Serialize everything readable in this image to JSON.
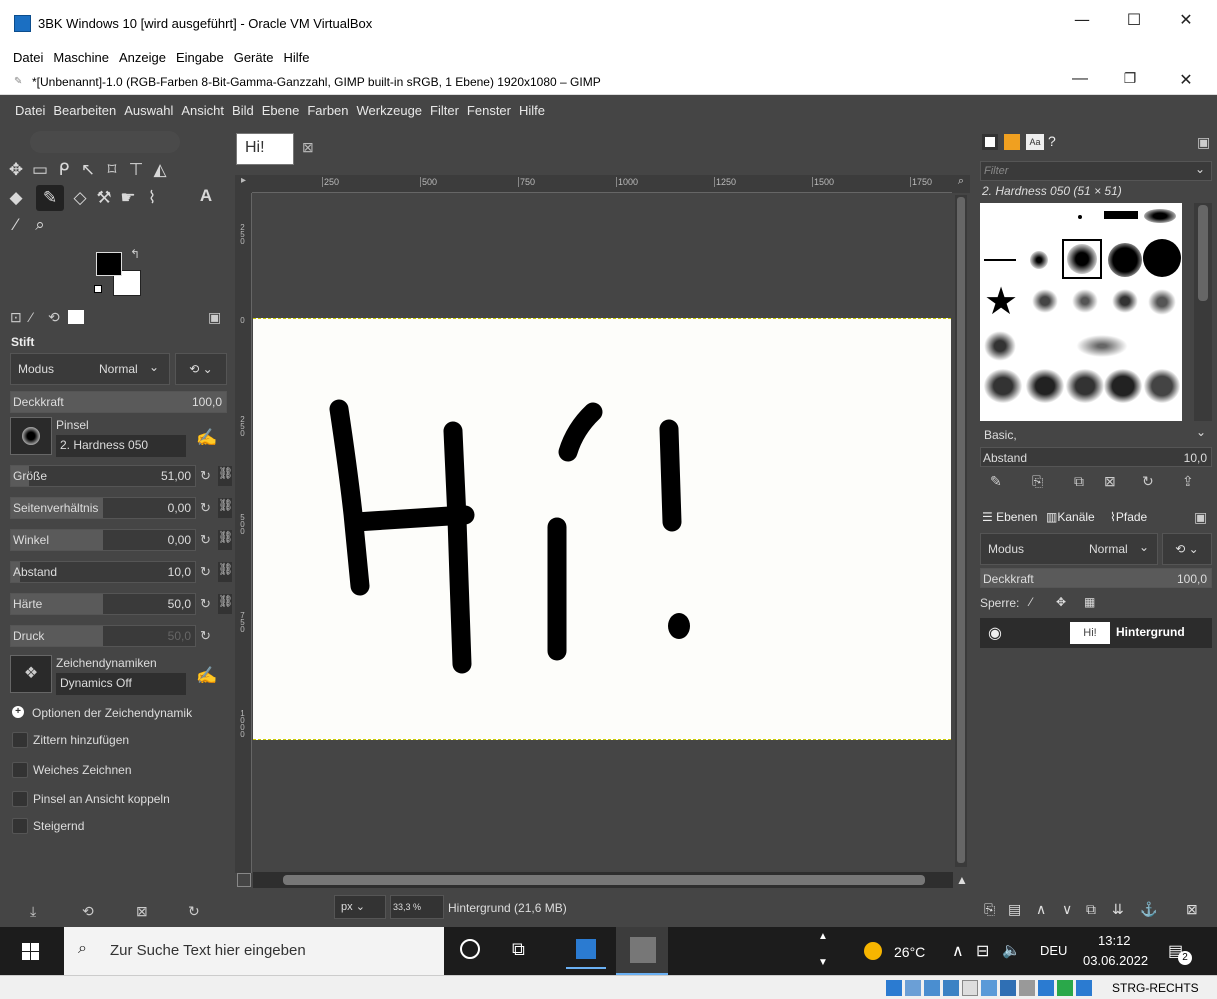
{
  "vbox": {
    "title": "3BK Windows 10 [wird ausgeführt] - Oracle VM VirtualBox",
    "menu": [
      "Datei",
      "Maschine",
      "Anzeige",
      "Eingabe",
      "Geräte",
      "Hilfe"
    ]
  },
  "gimp": {
    "title": "*[Unbenannt]-1.0 (RGB-Farben 8-Bit-Gamma-Ganzzahl, GIMP built-in sRGB, 1 Ebene) 1920x1080 – GIMP",
    "menu": [
      "Datei",
      "Bearbeiten",
      "Auswahl",
      "Ansicht",
      "Bild",
      "Ebene",
      "Farben",
      "Werkzeuge",
      "Filter",
      "Fenster",
      "Hilfe"
    ],
    "tab_thumb": "Hi!",
    "ruler": [
      "250",
      "500",
      "750",
      "1000",
      "1250",
      "1500",
      "1750"
    ],
    "vruler": [
      "250",
      "0",
      "250",
      "500",
      "750",
      "1000"
    ],
    "tool_options": {
      "heading": "Stift",
      "mode_label": "Modus",
      "mode_value": "Normal",
      "opacity_label": "Deckkraft",
      "opacity_value": "100,0",
      "brush_label": "Pinsel",
      "brush_name": "2. Hardness 050",
      "sliders": [
        {
          "label": "Größe",
          "value": "51,00",
          "fill": 0.1
        },
        {
          "label": "Seitenverhältnis",
          "value": "0,00",
          "fill": 0.5
        },
        {
          "label": "Winkel",
          "value": "0,00",
          "fill": 0.5
        },
        {
          "label": "Abstand",
          "value": "10,0",
          "fill": 0.05
        },
        {
          "label": "Härte",
          "value": "50,0",
          "fill": 0.5
        },
        {
          "label": "Druck",
          "value": "50,0",
          "fill": 0.5
        }
      ],
      "dynamics_label": "Zeichendynamiken",
      "dynamics_value": "Dynamics Off",
      "dynamics_options": "Optionen der Zeichendynamik",
      "checks": [
        "Zittern hinzufügen",
        "Weiches Zeichnen",
        "Pinsel an Ansicht koppeln",
        "Steigernd"
      ]
    },
    "statusbar": {
      "unit": "px",
      "zoom": "33,3 %",
      "layer_info": "Hintergrund (21,6 MB)"
    },
    "brushes": {
      "filter_placeholder": "Filter",
      "selected": "2. Hardness 050 (51 × 51)",
      "tag": "Basic,",
      "spacing_label": "Abstand",
      "spacing_value": "10,0"
    },
    "layers": {
      "tabs": [
        "Ebenen",
        "Kanäle",
        "Pfade"
      ],
      "mode_label": "Modus",
      "mode_value": "Normal",
      "opacity_label": "Deckkraft",
      "opacity_value": "100,0",
      "lock_label": "Sperre:",
      "layer_name": "Hintergrund",
      "layer_thumb": "Hi!"
    }
  },
  "taskbar": {
    "search_placeholder": "Zur Suche Text hier eingeben",
    "weather": "26°C",
    "lang": "DEU",
    "time": "13:12",
    "date": "03.06.2022",
    "notifications": "2"
  },
  "vbox_status": {
    "hostkey": "STRG-RECHTS"
  }
}
